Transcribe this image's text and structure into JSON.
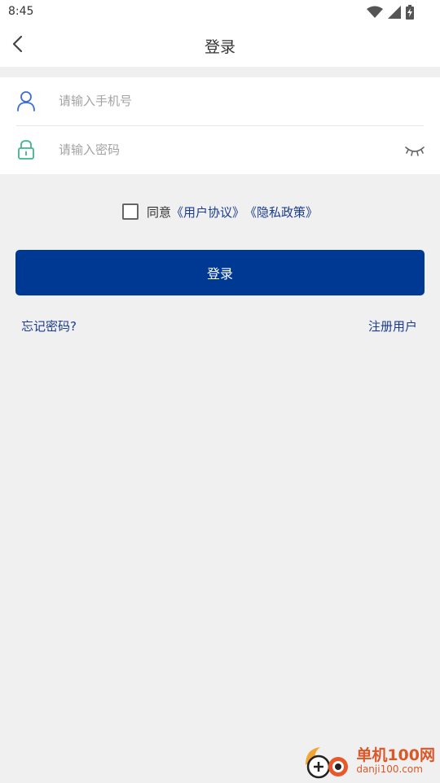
{
  "status_bar": {
    "time": "8:45",
    "icons": [
      "wifi-icon",
      "signal-icon",
      "battery-charging-icon"
    ]
  },
  "header": {
    "title": "登录",
    "back_icon": "chevron-left-icon"
  },
  "form": {
    "phone": {
      "value": "",
      "placeholder": "请输入手机号",
      "icon": "user-icon",
      "icon_color": "#3a6fd9"
    },
    "password": {
      "value": "",
      "placeholder": "请输入密码",
      "icon": "lock-icon",
      "icon_color": "#3fb58a",
      "toggle_icon": "eye-closed-icon"
    }
  },
  "agreement": {
    "checked": false,
    "prefix": "同意",
    "user_agreement": "《用户协议》",
    "privacy_policy": "《隐私政策》"
  },
  "login_button": {
    "label": "登录",
    "color": "#003994"
  },
  "links": {
    "forgot_password": "忘记密码?",
    "register": "注册用户",
    "color": "#1b3c8c"
  },
  "watermark": {
    "name": "单机100网",
    "url": "danji100.com"
  }
}
